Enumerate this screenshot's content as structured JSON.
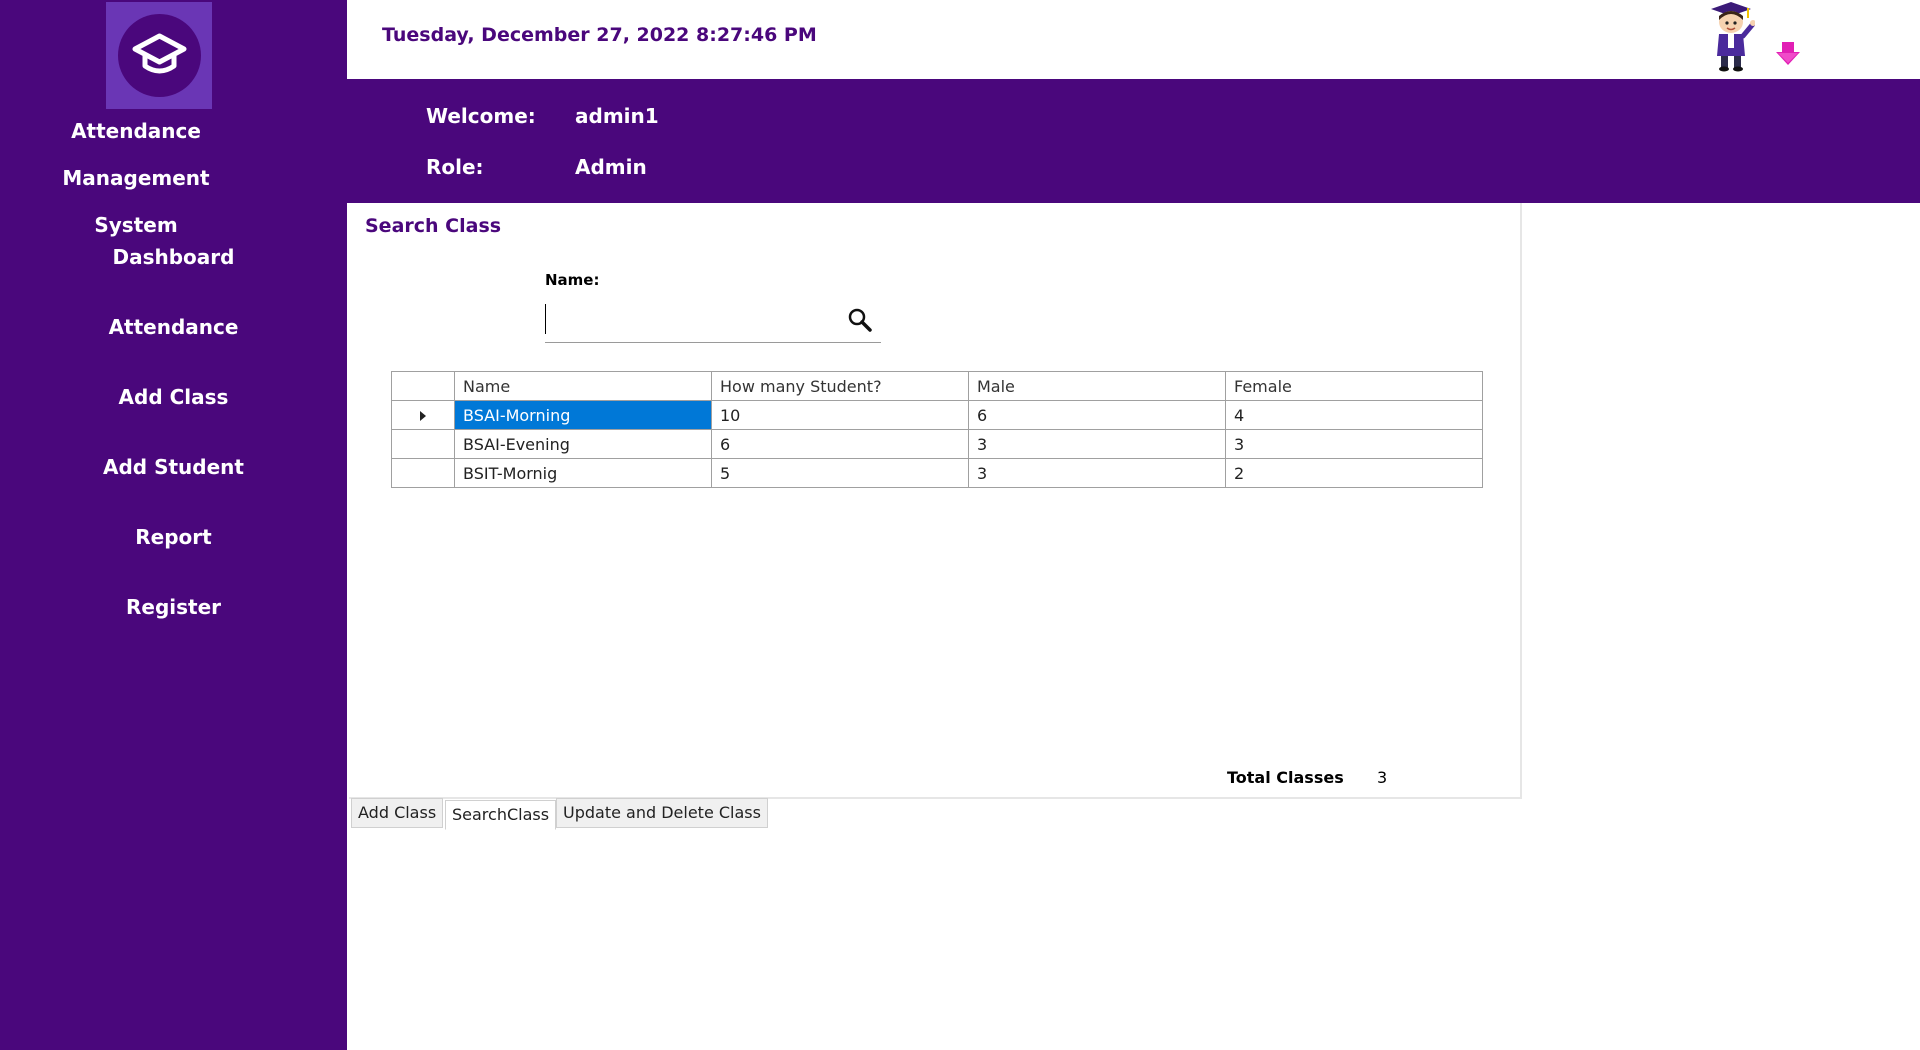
{
  "sidebar": {
    "app_title_line1": "Attendance Management",
    "app_title_line2": "System",
    "logo_icon": "graduation-cap-icon",
    "nav": [
      {
        "label": "Dashboard"
      },
      {
        "label": "Attendance"
      },
      {
        "label": "Add Class"
      },
      {
        "label": "Add Student"
      },
      {
        "label": "Report"
      },
      {
        "label": "Register"
      }
    ]
  },
  "header": {
    "datetime": "Tuesday, December 27, 2022 8:27:46 PM",
    "welcome_label": "Welcome:",
    "welcome_value": "admin1",
    "role_label": "Role:",
    "role_value": "Admin"
  },
  "search_panel": {
    "title": "Search Class",
    "name_label": "Name:",
    "search_value": "",
    "search_icon": "search-icon"
  },
  "table": {
    "columns": [
      "Name",
      "How many Student?",
      "Male",
      "Female"
    ],
    "rows": [
      {
        "name": "BSAI-Morning",
        "count": "10",
        "male": "6",
        "female": "4",
        "selected": true
      },
      {
        "name": "BSAI-Evening",
        "count": "6",
        "male": "3",
        "female": "3",
        "selected": false
      },
      {
        "name": "BSIT-Mornig",
        "count": "5",
        "male": "3",
        "female": "2",
        "selected": false
      }
    ]
  },
  "footer": {
    "total_label": "Total Classes",
    "total_value": "3"
  },
  "tabs": [
    {
      "label": "Add Class",
      "active": false
    },
    {
      "label": "SearchClass",
      "active": true
    },
    {
      "label": "Update and Delete Class",
      "active": false
    }
  ],
  "colors": {
    "primary": "#4a077c",
    "logo_bg": "#6a36b5",
    "selection": "#0078d7",
    "arrow": "#e11fb4"
  }
}
